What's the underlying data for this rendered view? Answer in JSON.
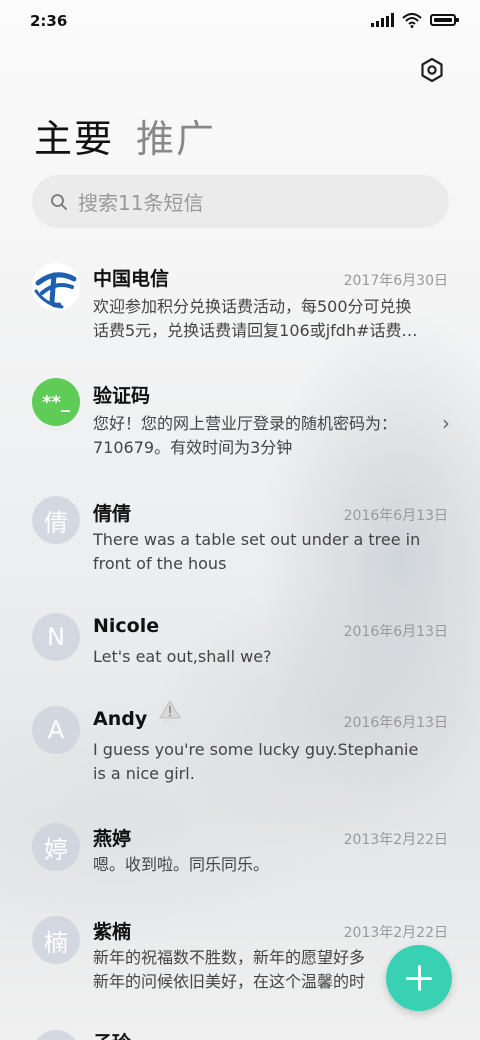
{
  "status_bar": {
    "time": "2:36"
  },
  "tabs": [
    {
      "label": "主要",
      "active": true
    },
    {
      "label": "推广",
      "active": false
    }
  ],
  "search": {
    "placeholder": "搜索11条短信"
  },
  "conversations": [
    {
      "name": "中国电信",
      "date": "2017年6月30日",
      "line1": "欢迎参加积分兑换话费活动，每500分可兑换",
      "line2": "话费5元，兑换话费请回复106或jfdh#话费…",
      "avatar": "telecom-logo"
    },
    {
      "name": "验证码",
      "date": "",
      "line1": "您好！您的网上营业厅登录的随机密码为：",
      "line2": "710679。有效时间为3分钟",
      "avatar_text": "**_",
      "avatar_color": "#5fcc57"
    },
    {
      "name": "倩倩",
      "date": "2016年6月13日",
      "line1": "There was a table set out under a tree in",
      "line2": "front of the hous",
      "avatar_text": "倩"
    },
    {
      "name": "Nicole",
      "date": "2016年6月13日",
      "line1": "Let's eat out,shall we?",
      "line2": "",
      "avatar_text": "N"
    },
    {
      "name": "Andy",
      "date": "2016年6月13日",
      "line1": "I guess you're some lucky guy.Stephanie",
      "line2": "is a nice girl.",
      "avatar_text": "A",
      "warning": true
    },
    {
      "name": "燕婷",
      "date": "2013年2月22日",
      "line1": "嗯。收到啦。同乐同乐。",
      "line2": "",
      "avatar_text": "婷"
    },
    {
      "name": "紫楠",
      "date": "2013年2月22日",
      "line1": "新年的祝福数不胜数，新年的愿望好多",
      "line2": "新年的问候依旧美好，在这个温馨的时",
      "avatar_text": "楠"
    },
    {
      "name": "子玲",
      "date": "",
      "line1": "",
      "line2": "",
      "avatar_text": ""
    }
  ],
  "colors": {
    "accent": "#39d1b3",
    "verify_green": "#5fcc57",
    "telecom_blue": "#1f5fb0"
  },
  "icons": {
    "settings": "settings-hexagon-icon",
    "fab": "plus-icon",
    "search": "search-icon"
  }
}
